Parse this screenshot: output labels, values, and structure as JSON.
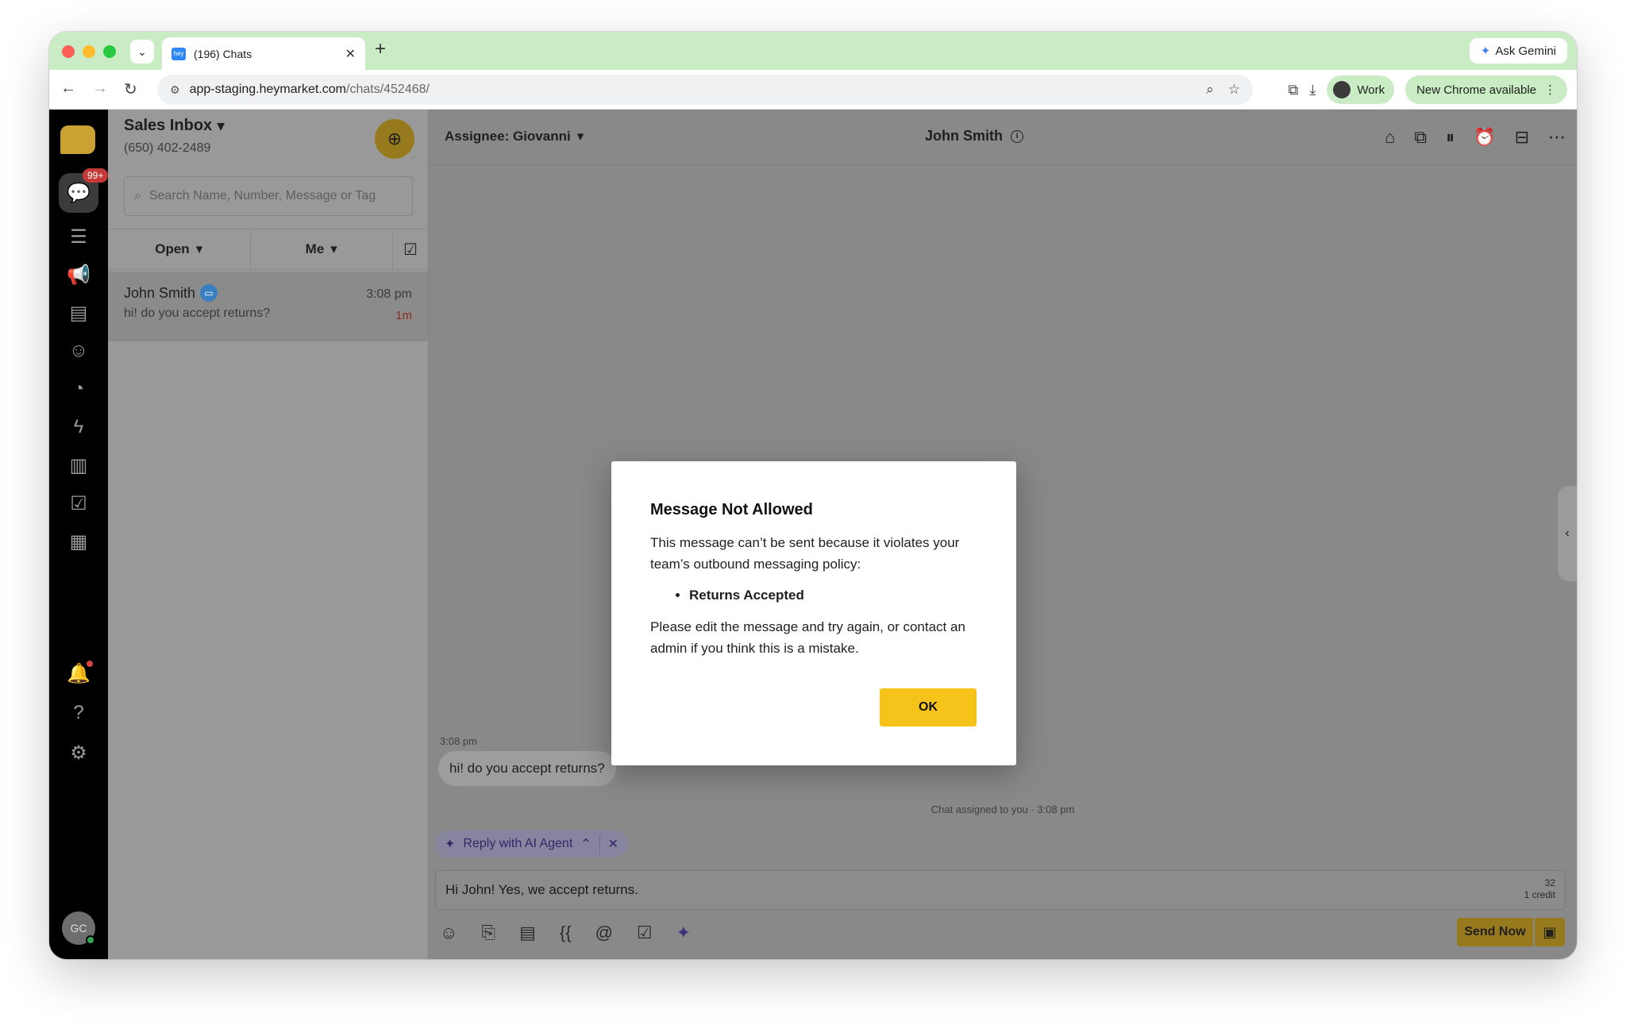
{
  "browser": {
    "tab_title": "(196) Chats",
    "favicon_text": "hey",
    "url_host": "app-staging.heymarket.com",
    "url_path": "/chats/452468/",
    "ask_gemini": "Ask Gemini",
    "profile": "Work",
    "update": "New Chrome available"
  },
  "rail": {
    "badge": "99+",
    "avatar_initials": "GC"
  },
  "sidebar": {
    "inbox_title": "Sales Inbox",
    "inbox_phone": "(650) 402-2489",
    "search_placeholder": "Search Name, Number, Message or Tag",
    "filter_status": "Open",
    "filter_owner": "Me",
    "chats": [
      {
        "name": "John Smith",
        "time": "3:08 pm",
        "preview": "hi! do you accept returns?",
        "age": "1m"
      }
    ]
  },
  "main": {
    "assignee": "Assignee: Giovanni",
    "contact_name": "John Smith",
    "messages": [
      {
        "time": "3:08 pm",
        "text": "hi! do you accept returns?"
      }
    ],
    "system_note": "Chat assigned to you · 3:08 pm",
    "ai_chip_label": "Reply with AI Agent",
    "composer_text": "Hi John! Yes, we accept returns.",
    "char_count": "32",
    "credit": "1 credit",
    "send_label": "Send Now"
  },
  "modal": {
    "title": "Message Not Allowed",
    "body": "This message can’t be sent because it violates your team’s outbound messaging policy:",
    "violations": [
      "Returns Accepted"
    ],
    "footer": "Please edit the message and try again, or contact an admin if you think this is a mistake.",
    "ok_label": "OK"
  },
  "colors": {
    "accent_yellow": "#f6c31b",
    "tabstrip_green": "#c9ecc4",
    "badge_red": "#c43a36"
  }
}
